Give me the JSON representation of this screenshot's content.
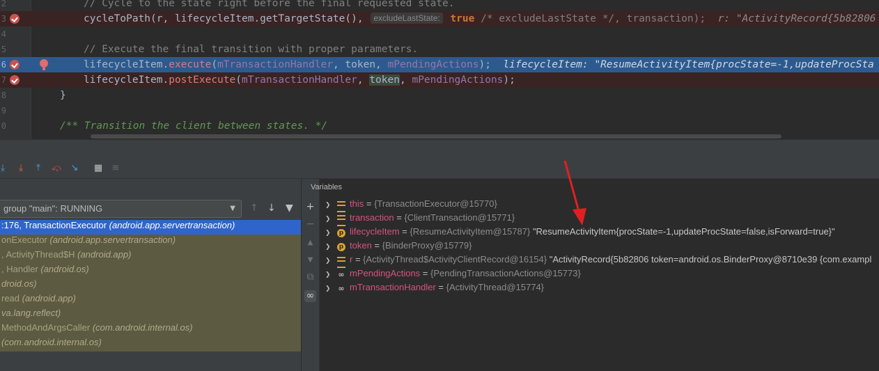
{
  "editor": {
    "lines": [
      {
        "num": "2",
        "kind": "normal"
      },
      {
        "num": "3",
        "kind": "breakpoint"
      },
      {
        "num": "4",
        "kind": "normal"
      },
      {
        "num": "5",
        "kind": "normal"
      },
      {
        "num": "6",
        "kind": "exec"
      },
      {
        "num": "7",
        "kind": "breakpoint"
      },
      {
        "num": "8",
        "kind": "normal"
      },
      {
        "num": "9",
        "kind": "normal"
      },
      {
        "num": "0",
        "kind": "normal"
      }
    ],
    "code": {
      "l1": "// Cycle to the state right before the final requested state.",
      "l2_a": "cycleToPath(r, lifecycleItem.getTargetState(), ",
      "l2_hint": "excludeLastState:",
      "l2_kw": " true",
      "l2_b": " /* excludeLastState */, transaction);",
      "l2_inline": "  r: \"ActivityRecord{5b82806",
      "l4": "// Execute the final transition with proper parameters.",
      "l5_obj": "lifecycleItem.",
      "l5_mth": "execute",
      "l5_args_a": "(",
      "l5_f1": "mTransactionHandler",
      "l5_args_b": ", token, ",
      "l5_f2": "mPendingActions",
      "l5_args_c": ");",
      "l5_inline": "  lifecycleItem: \"ResumeActivityItem{procState=-1,updateProcSta",
      "l6_obj": "lifecycleItem.",
      "l6_mth": "postExecute",
      "l6_args_a": "(",
      "l6_f1": "mTransactionHandler",
      "l6_args_b": ", ",
      "l6_tok": "token",
      "l6_args_c": ", ",
      "l6_f2": "mPendingActions",
      "l6_args_d": ");",
      "l7": "}",
      "l9": "/** Transition the client between states. */"
    }
  },
  "debugger": {
    "thread_select": "group \"main\": RUNNING",
    "frames": [
      {
        "loc": ":176, TransactionExecutor ",
        "pkg": "(android.app.servertransaction)",
        "selected": true
      },
      {
        "loc": "onExecutor ",
        "pkg": "(android.app.servertransaction)",
        "selected": false
      },
      {
        "loc": ", ActivityThread$H ",
        "pkg": "(android.app)",
        "selected": false
      },
      {
        "loc": ", Handler ",
        "pkg": "(android.os)",
        "selected": false
      },
      {
        "loc": "",
        "pkg": "droid.os)",
        "selected": false
      },
      {
        "loc": "read ",
        "pkg": "(android.app)",
        "selected": false
      },
      {
        "loc": "",
        "pkg": "va.lang.reflect)",
        "selected": false
      },
      {
        "loc": "MethodAndArgsCaller ",
        "pkg": "(com.android.internal.os)",
        "selected": false
      },
      {
        "loc": "",
        "pkg": "(com.android.internal.os)",
        "selected": false
      }
    ]
  },
  "variables": {
    "title": "Variables",
    "items": [
      {
        "icon": "list-icon",
        "name": "this",
        "type": "{TransactionExecutor@15770}",
        "value": ""
      },
      {
        "icon": "list-icon",
        "name": "transaction",
        "type": "{ClientTransaction@15771}",
        "value": ""
      },
      {
        "icon": "param-icon",
        "name": "lifecycleItem",
        "type": "{ResumeActivityItem@15787}",
        "value": " \"ResumeActivityItem{procState=-1,updateProcState=false,isForward=true}\""
      },
      {
        "icon": "param-icon",
        "name": "token",
        "type": "{BinderProxy@15779}",
        "value": ""
      },
      {
        "icon": "list-icon",
        "name": "r",
        "type": "{ActivityThread$ActivityClientRecord@16154}",
        "value": " \"ActivityRecord{5b82806 token=android.os.BinderProxy@8710e39 {com.exampl"
      },
      {
        "icon": "watch-icon",
        "name": "mPendingActions",
        "type": "{PendingTransactionActions@15773}",
        "value": ""
      },
      {
        "icon": "watch-icon",
        "name": "mTransactionHandler",
        "type": "{ActivityThread@15774}",
        "value": ""
      }
    ]
  },
  "colors": {
    "annotation_arrow": "#e02020",
    "exec_line": "#2d5a8e",
    "breakpoint": "#c75450"
  }
}
